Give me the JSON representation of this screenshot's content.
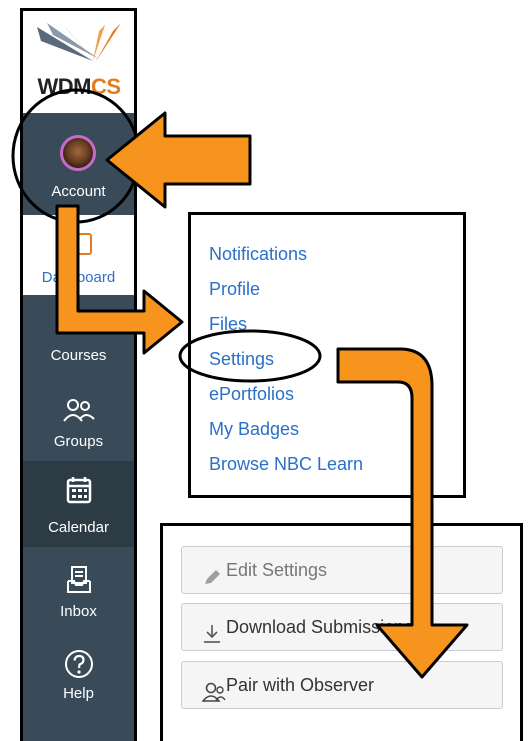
{
  "sidebar": {
    "logo": {
      "text_main": "WDM",
      "text_accent": "CS"
    },
    "items": [
      {
        "label": "Account",
        "icon": "avatar"
      },
      {
        "label": "Dashboard",
        "icon": "dashboard-icon"
      },
      {
        "label": "Courses",
        "icon": "book-icon"
      },
      {
        "label": "Groups",
        "icon": "groups-icon"
      },
      {
        "label": "Calendar",
        "icon": "calendar-icon"
      },
      {
        "label": "Inbox",
        "icon": "inbox-icon"
      },
      {
        "label": "Help",
        "icon": "help-icon"
      }
    ]
  },
  "account_menu": {
    "items": [
      "Notifications",
      "Profile",
      "Files",
      "Settings",
      "ePortfolios",
      "My Badges",
      "Browse NBC Learn"
    ]
  },
  "settings_buttons": [
    {
      "label": "Edit Settings",
      "icon": "pencil-icon"
    },
    {
      "label": "Download Submissions",
      "icon": "download-icon"
    },
    {
      "label": "Pair with Observer",
      "icon": "observer-icon"
    }
  ],
  "colors": {
    "sidebar_bg": "#394b58",
    "link": "#2a6fc9",
    "arrow": "#f7941d",
    "accent": "#e47b1f"
  }
}
